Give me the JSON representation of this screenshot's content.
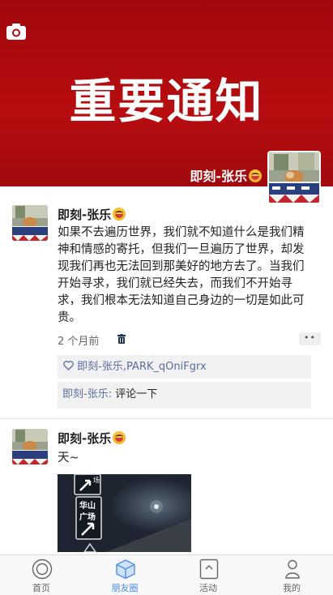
{
  "cover": {
    "title": "重要通知",
    "user_name": "即刻-张乐",
    "emoji_icon": "grinning-face-emoji",
    "background_color": "#a9090d"
  },
  "posts": [
    {
      "author": "即刻-张乐",
      "text": "如果不去遍历世界，我们就不知道什么是我们精神和情感的寄托，但我们一旦遍历了世界，却发现我们再也无法回到那美好的地方去了。当我们开始寻求，我们就已经失去，而我们不开始寻求，我们根本无法知道自己身边的一切是如此可贵。",
      "time": "2 个月前",
      "more_label": "••",
      "likes": "即刻-张乐,PARK_qOniFgrx",
      "comment": {
        "author": "即刻-张乐:",
        "text": " 评论一下"
      }
    },
    {
      "author": "即刻-张乐",
      "text": "天~",
      "image_signs": [
        "华山广场",
        "华山广场"
      ]
    }
  ],
  "tabbar": {
    "accent_color": "#4b8ee8",
    "items": [
      {
        "label": "首页",
        "icon": "home-circle-icon"
      },
      {
        "label": "朋友圈",
        "icon": "moments-cube-icon",
        "active": true
      },
      {
        "label": "活动",
        "icon": "activity-icon"
      },
      {
        "label": "我的",
        "icon": "profile-icon"
      }
    ]
  }
}
